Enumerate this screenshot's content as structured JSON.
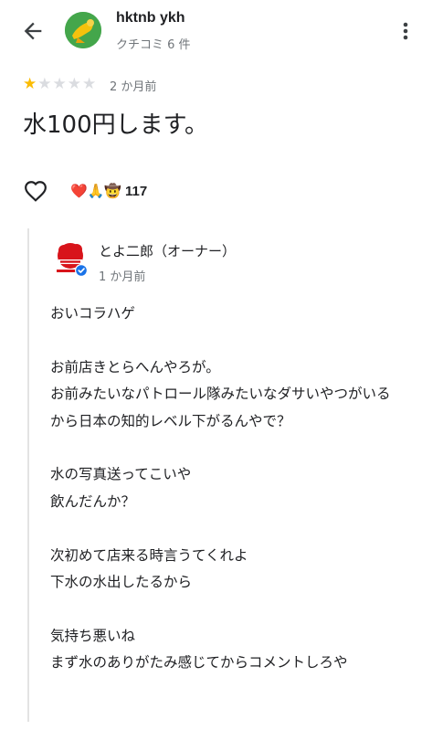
{
  "header": {
    "user_name": "hktnb ykh",
    "review_count": "クチコミ 6 件"
  },
  "review": {
    "rating": 1,
    "max_rating": 5,
    "time": "2 か月前",
    "text": "水100円します。",
    "reactions": {
      "emojis": "❤️🙏🤠",
      "count": "117"
    }
  },
  "owner_reply": {
    "name": "とよ二郎（オーナー）",
    "time": "1 か月前",
    "text": "おいコラハゲ\n\nお前店きとらへんやろが。\nお前みたいなパトロール隊みたいなダサいやつがいる\nから日本の知的レベル下がるんやで？\n\n水の写真送ってこいや\n飲んだんか？\n\n次初めて店来る時言うてくれよ\n下水の水出したるから\n\n気持ち悪いね\nまず水のありがたみ感じてからコメントしろや"
  },
  "icons": {
    "back": "arrow-back-icon",
    "more": "more-vert-icon",
    "like": "heart-outline-icon",
    "verified": "verified-check-icon"
  },
  "colors": {
    "star_on": "#fbbc04",
    "star_off": "#dadce0",
    "verified": "#1a73e8",
    "secondary_text": "#70757a"
  }
}
